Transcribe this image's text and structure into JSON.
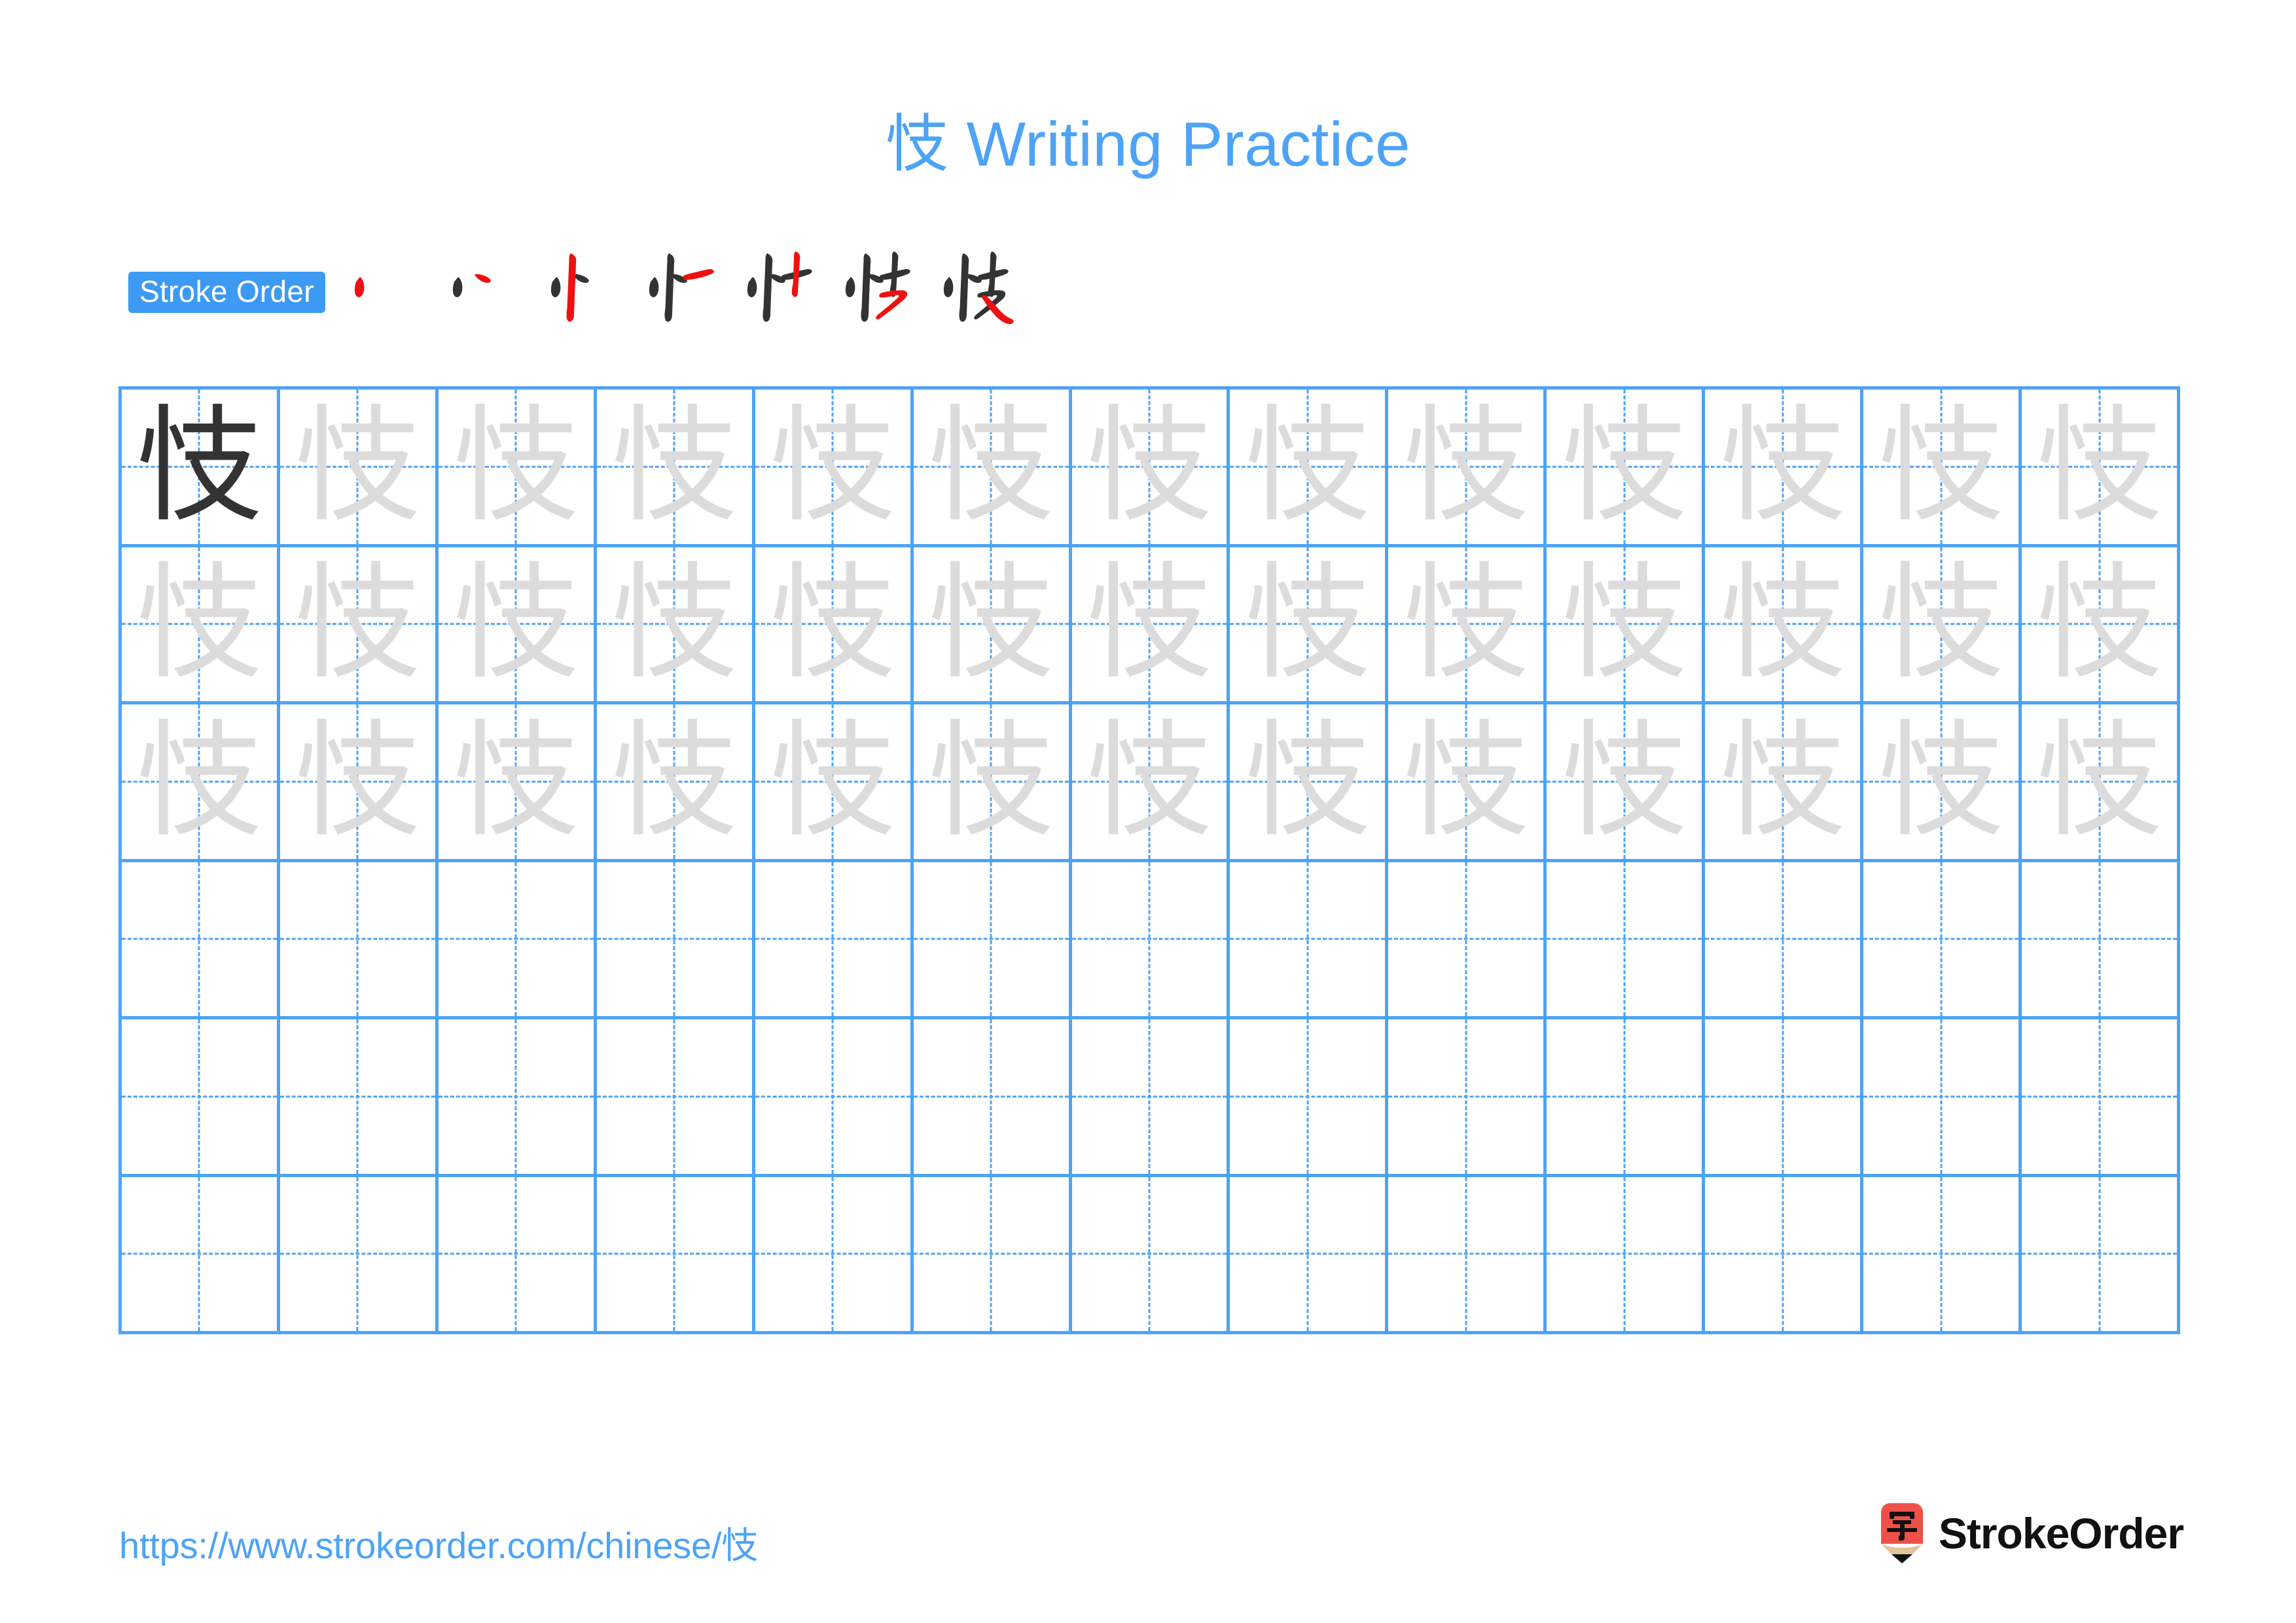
{
  "page": {
    "character": "忮",
    "title": "忮 Writing Practice",
    "background_color": "#ffffff",
    "accent_color": "#4da3f5"
  },
  "stroke_order": {
    "badge_label": "Stroke Order",
    "badge_bg_color": "#3d9af2",
    "badge_text_color": "#ffffff",
    "new_stroke_color": "#ee1111",
    "prior_stroke_color": "#333333",
    "total_strokes": 7,
    "steps": [
      {
        "index": 1,
        "label": "丿"
      },
      {
        "index": 2,
        "label": "丷"
      },
      {
        "index": 3,
        "label": "忄"
      },
      {
        "index": 4,
        "label": "忄一"
      },
      {
        "index": 5,
        "label": "忄十"
      },
      {
        "index": 6,
        "label": "忮 (6 strokes)"
      },
      {
        "index": 7,
        "label": "忮"
      }
    ]
  },
  "practice_grid": {
    "columns": 13,
    "rows": 6,
    "grid_line_color": "#4da3f5",
    "guide_line_color": "#4da3f5",
    "traced_char_color": "#dcdcdc",
    "model_char_color": "#333333",
    "rows_data": [
      {
        "row": 1,
        "filled": true,
        "model_first_cell": true
      },
      {
        "row": 2,
        "filled": true,
        "model_first_cell": false
      },
      {
        "row": 3,
        "filled": true,
        "model_first_cell": false
      },
      {
        "row": 4,
        "filled": false,
        "model_first_cell": false
      },
      {
        "row": 5,
        "filled": false,
        "model_first_cell": false
      },
      {
        "row": 6,
        "filled": false,
        "model_first_cell": false
      }
    ]
  },
  "footer": {
    "url": "https://www.strokeorder.com/chinese/忮",
    "brand_name": "StrokeOrder",
    "logo_char": "字",
    "logo_body_color": "#f0504a",
    "logo_tip_color": "#e3c49b",
    "logo_point_color": "#111111"
  }
}
